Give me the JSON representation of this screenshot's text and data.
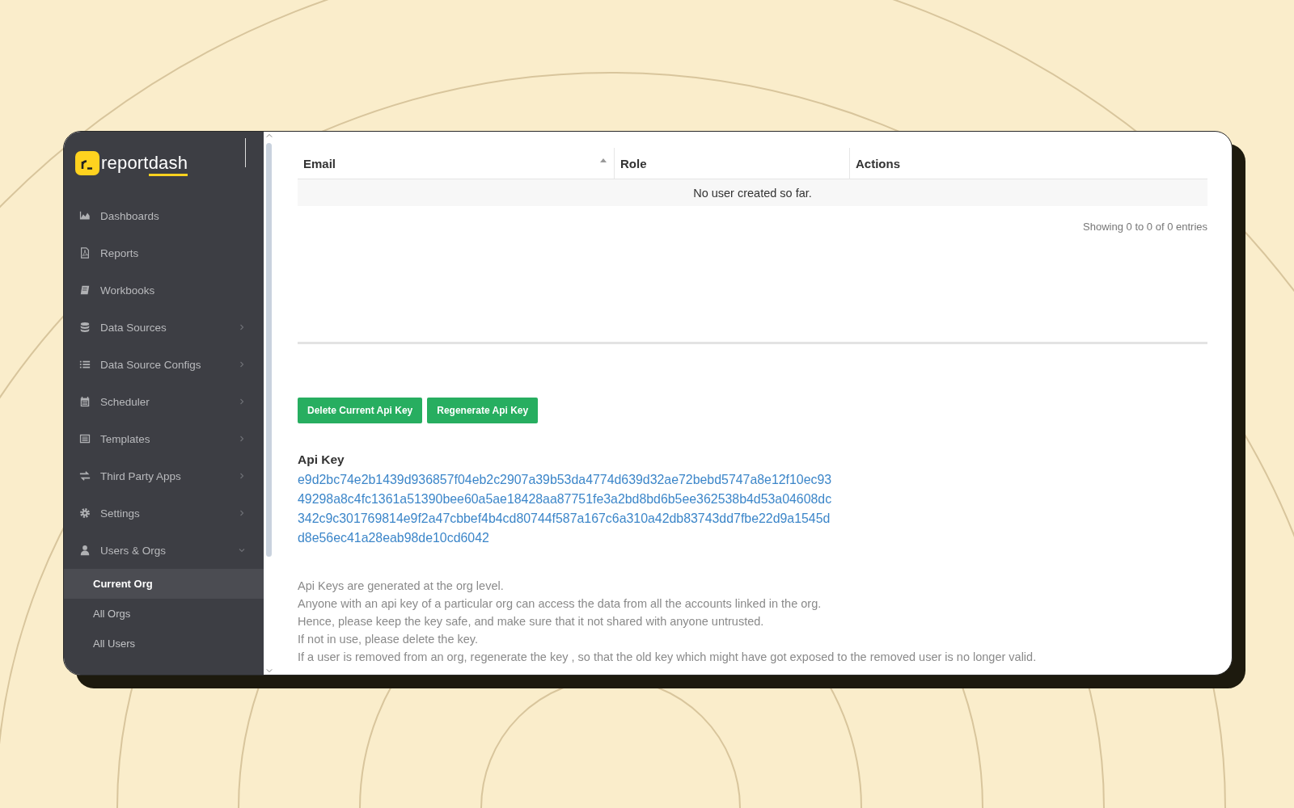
{
  "logo": {
    "prefix": "report",
    "suffix": "dash"
  },
  "sidebar": {
    "items": [
      {
        "label": "Dashboards"
      },
      {
        "label": "Reports"
      },
      {
        "label": "Workbooks"
      },
      {
        "label": "Data Sources",
        "expanded": false
      },
      {
        "label": "Data Source Configs",
        "expanded": false
      },
      {
        "label": "Scheduler",
        "expanded": false
      },
      {
        "label": "Templates",
        "expanded": false
      },
      {
        "label": "Third Party Apps",
        "expanded": false
      },
      {
        "label": "Settings",
        "expanded": false
      },
      {
        "label": "Users & Orgs",
        "expanded": true,
        "children": [
          {
            "label": "Current Org",
            "selected": true
          },
          {
            "label": "All Orgs",
            "selected": false
          },
          {
            "label": "All Users",
            "selected": false
          }
        ]
      }
    ]
  },
  "table": {
    "columns": [
      {
        "label": "Email",
        "sorted": true
      },
      {
        "label": "Role",
        "sorted": false
      },
      {
        "label": "Actions",
        "sorted": false
      }
    ],
    "empty_message": "No user created so far.",
    "info": "Showing 0 to 0 of 0 entries"
  },
  "buttons": [
    "Delete Current Api Key",
    "Regenerate Api Key"
  ],
  "api_key": {
    "label": "Api Key",
    "lines": [
      "e9d2bc74e2b1439d936857f04eb2c2907a39b53da4774d639d32ae72bebd5747a8e12f10ec93",
      "49298a8c4fc1361a51390bee60a5ae18428aa87751fe3a2bd8bd6b5ee362538b4d53a04608dc",
      "342c9c301769814e9f2a47cbbef4b4cd80744f587a167c6a310a42db83743dd7fbe22d9a1545d",
      "d8e56ec41a28eab98de10cd6042"
    ]
  },
  "notes": [
    "Api Keys are generated at the org level.",
    "Anyone with an api key of a particular org can access the data from all the accounts linked in the org.",
    "Hence, please keep the key safe, and make sure that it not shared with anyone untrusted.",
    "If not in use, please delete the key.",
    "If a user is removed from an org, regenerate the key , so that the old key which might have got exposed to the removed user is no longer valid."
  ]
}
